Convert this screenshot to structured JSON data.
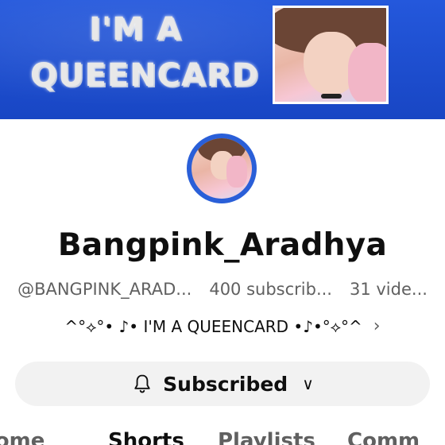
{
  "banner": {
    "line1": "I'M A",
    "line2": "QUEENCARD"
  },
  "channel": {
    "name": "Bangpink_Aradhya",
    "handle": "@BANGPINK_ARAD...",
    "subscribers": "400 subscrib...",
    "videos": "31 vide...",
    "description": "^°⟡°• ♪• I'M A QUEENCARD •♪•°⟡°^",
    "description_chevron": "›"
  },
  "subscribe_button": {
    "label": "Subscribed",
    "icon": "bell-icon",
    "chevron": "∨"
  },
  "tabs": [
    {
      "label": "Home",
      "active": false
    },
    {
      "label": "Shorts",
      "active": true
    },
    {
      "label": "Playlists",
      "active": false
    },
    {
      "label": "Comm",
      "active": false
    }
  ],
  "colors": {
    "banner_blue": "#1f4fd0",
    "button_bg": "#f2f2f2",
    "secondary_text": "#606060"
  }
}
